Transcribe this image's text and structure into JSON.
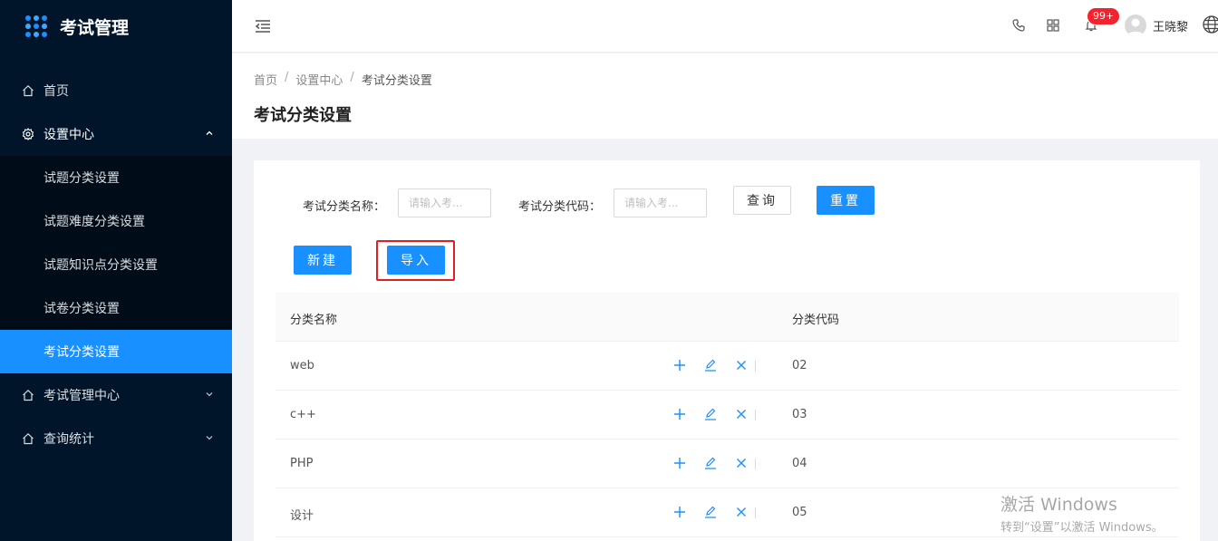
{
  "app": {
    "title": "考试管理"
  },
  "sidebar": {
    "items": [
      {
        "label": "首页"
      },
      {
        "label": "设置中心"
      },
      {
        "label": "考试管理中心"
      },
      {
        "label": "查询统计"
      }
    ],
    "settings_sub": [
      {
        "label": "试题分类设置"
      },
      {
        "label": "试题难度分类设置"
      },
      {
        "label": "试题知识点分类设置"
      },
      {
        "label": "试卷分类设置"
      },
      {
        "label": "考试分类设置"
      }
    ]
  },
  "header": {
    "badge": "99+",
    "username": "王晓黎"
  },
  "breadcrumb": [
    "首页",
    "设置中心",
    "考试分类设置"
  ],
  "page_title": "考试分类设置",
  "search": {
    "name_label": "考试分类名称：",
    "name_placeholder": "请输入考...",
    "code_label": "考试分类代码：",
    "code_placeholder": "请输入考...",
    "query_label": "查询",
    "reset_label": "重置"
  },
  "toolbar": {
    "new_label": "新建",
    "import_label": "导入"
  },
  "table": {
    "columns": [
      "分类名称",
      "分类代码"
    ],
    "rows": [
      {
        "name": "web",
        "code": "02"
      },
      {
        "name": "c++",
        "code": "03"
      },
      {
        "name": "PHP",
        "code": "04"
      },
      {
        "name": "设计",
        "code": "05"
      }
    ]
  },
  "watermark": {
    "line1": "激活 Windows",
    "line2": "转到“设置”以激活 Windows。"
  },
  "colors": {
    "primary": "#1890ff",
    "sidebar": "#001529",
    "highlight": "#e02020"
  }
}
